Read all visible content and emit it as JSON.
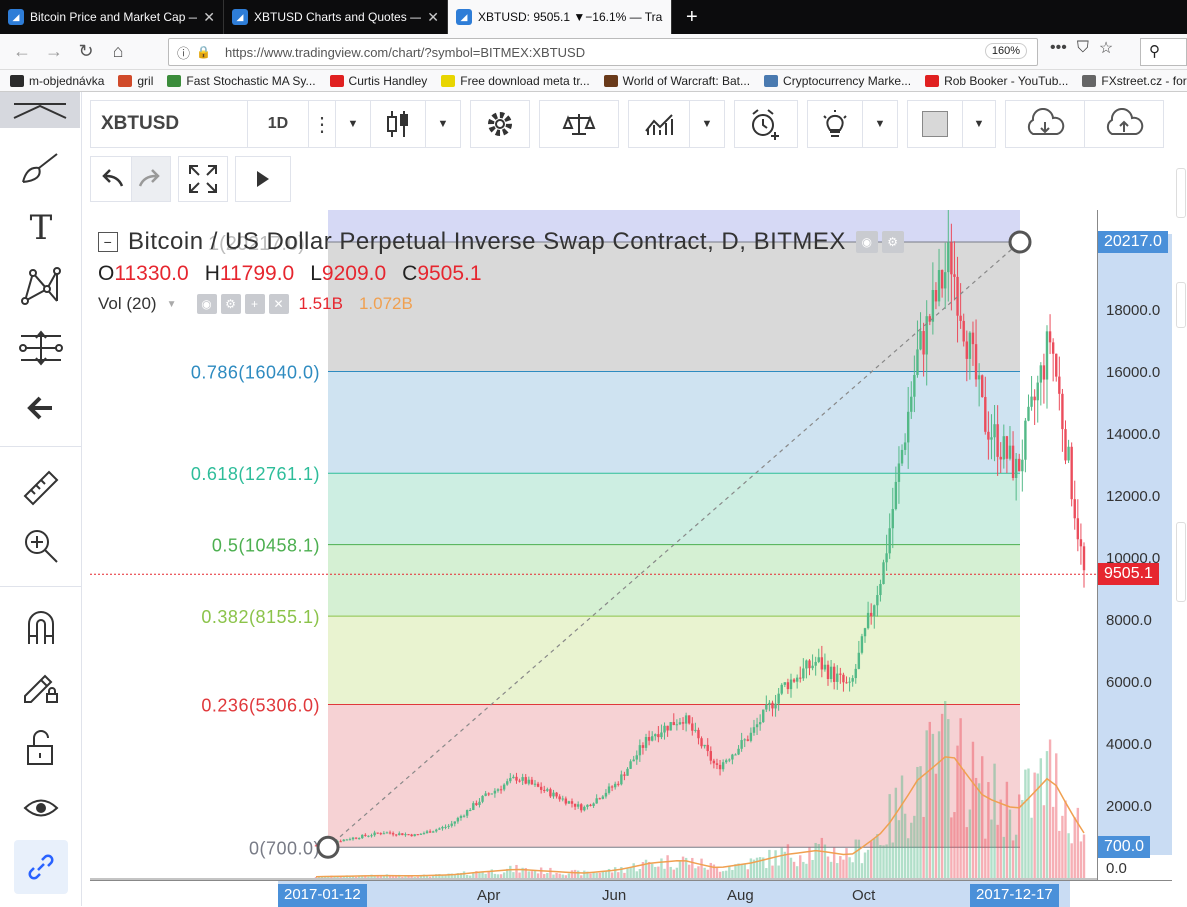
{
  "browser": {
    "tabs": [
      {
        "title": "Bitcoin Price and Market Cap —",
        "active": false
      },
      {
        "title": "XBTUSD Charts and Quotes — T",
        "active": false
      },
      {
        "title": "XBTUSD: 9505.1 ▼−16.1% — Tra",
        "active": true
      }
    ],
    "url": "https://www.tradingview.com/chart/?symbol=BITMEX:XBTUSD",
    "zoom": "160%",
    "bookmarks": [
      {
        "label": "m-objednávka",
        "color": "#2b2b2b"
      },
      {
        "label": "gril",
        "color": "#d04a2a"
      },
      {
        "label": "Fast Stochastic MA Sy...",
        "color": "#3b8c3b"
      },
      {
        "label": "Curtis Handley",
        "color": "#e02020"
      },
      {
        "label": "Free download meta tr...",
        "color": "#e8d500"
      },
      {
        "label": "World of Warcraft: Bat...",
        "color": "#6a3a1a"
      },
      {
        "label": "Cryptocurrency Marke...",
        "color": "#4a7ab0"
      },
      {
        "label": "Rob Booker - YouTub...",
        "color": "#e02020"
      },
      {
        "label": "FXstreet.cz - for",
        "color": "#666666"
      }
    ]
  },
  "toolbar": {
    "symbol": "XBTUSD",
    "resolution": "1D"
  },
  "legend": {
    "title": "Bitcoin / US Dollar Perpetual Inverse Swap Contract, D, BITMEX",
    "o_label": "O",
    "o": "11330.0",
    "h_label": "H",
    "h": "11799.0",
    "l_label": "L",
    "l": "9209.0",
    "c_label": "C",
    "c": "9505.1",
    "vol_label": "Vol (20)",
    "vol1": "1.51B",
    "vol2": "1.072B",
    "hidden_label": "1(20217.0)"
  },
  "fib_levels": [
    {
      "label": "0.786(16040.0)",
      "price": 16040.0,
      "color": "#2e8bc0"
    },
    {
      "label": "0.618(12761.1)",
      "price": 12761.1,
      "color": "#2ebd9a"
    },
    {
      "label": "0.5(10458.1)",
      "price": 10458.1,
      "color": "#4caf50"
    },
    {
      "label": "0.382(8155.1)",
      "price": 8155.1,
      "color": "#8bc34a"
    },
    {
      "label": "0.236(5306.0)",
      "price": 5306.0,
      "color": "#e0383b"
    },
    {
      "label": "0(700.0)",
      "price": 700.0,
      "color": "#787b86"
    }
  ],
  "price_axis": {
    "ticks": [
      "18000.0",
      "16000.0",
      "14000.0",
      "12000.0",
      "10000.0",
      "8000.0",
      "6000.0",
      "4000.0",
      "2000.0",
      "0.0"
    ],
    "high_tag": "20217.0",
    "last_tag": "9505.1",
    "low_tag": "700.0"
  },
  "time_axis": {
    "start_tag": "2017-01-12",
    "end_tag": "2017-12-17",
    "ticks": [
      "Apr",
      "Jun",
      "Aug",
      "Oct"
    ]
  },
  "colors": {
    "accent": "#2962ff",
    "up": "#53b987",
    "down": "#eb4d5c",
    "last_price": "#e6262f",
    "axis_tag": "#4a90d9"
  },
  "chart_data": {
    "type": "candlestick",
    "title": "Bitcoin / US Dollar Perpetual Inverse Swap Contract, D, BITMEX",
    "xlabel": "",
    "ylabel": "",
    "ylim": [
      0,
      20500
    ],
    "x": [
      "2017-01-12",
      "2017-02-01",
      "2017-03-01",
      "2017-04-01",
      "2017-05-01",
      "2017-05-25",
      "2017-06-12",
      "2017-07-01",
      "2017-07-16",
      "2017-08-01",
      "2017-08-17",
      "2017-09-02",
      "2017-09-15",
      "2017-10-01",
      "2017-10-20",
      "2017-11-01",
      "2017-11-12",
      "2017-11-28",
      "2017-12-07",
      "2017-12-17",
      "2017-12-22",
      "2017-12-30",
      "2018-01-07",
      "2018-01-16"
    ],
    "series": [
      {
        "name": "",
        "values": [
          760,
          980,
          1180,
          1090,
          1400,
          2300,
          2950,
          2450,
          1950,
          2750,
          4300,
          4900,
          3250,
          4300,
          5900,
          6700,
          5800,
          9800,
          16500,
          19800,
          14500,
          12800,
          17200,
          9505
        ]
      }
    ]
  }
}
